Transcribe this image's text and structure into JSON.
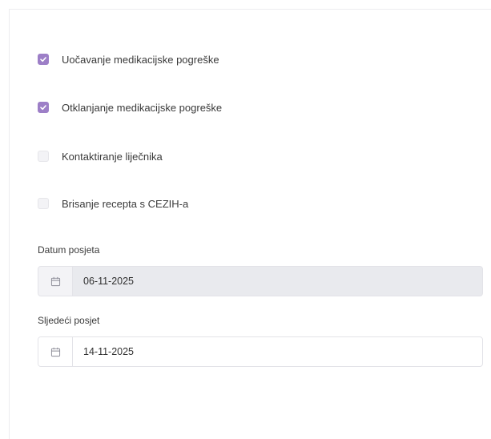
{
  "checkboxes": [
    {
      "label": "Uočavanje medikacijske pogreške",
      "checked": true
    },
    {
      "label": "Otklanjanje medikacijske pogreške",
      "checked": true
    },
    {
      "label": "Kontaktiranje liječnika",
      "checked": false
    },
    {
      "label": "Brisanje recepta s CEZIH-a",
      "checked": false
    }
  ],
  "visit_date": {
    "label": "Datum posjeta",
    "value": "06-11-2025",
    "disabled": true,
    "icon": "calendar-icon"
  },
  "next_visit": {
    "label": "Sljedeći posjet",
    "value": "14-11-2025",
    "disabled": false,
    "icon": "calendar-icon"
  },
  "colors": {
    "accent": "#9d7fc7",
    "disabled_bg": "#e9eaee",
    "border": "#e3e3e8"
  }
}
